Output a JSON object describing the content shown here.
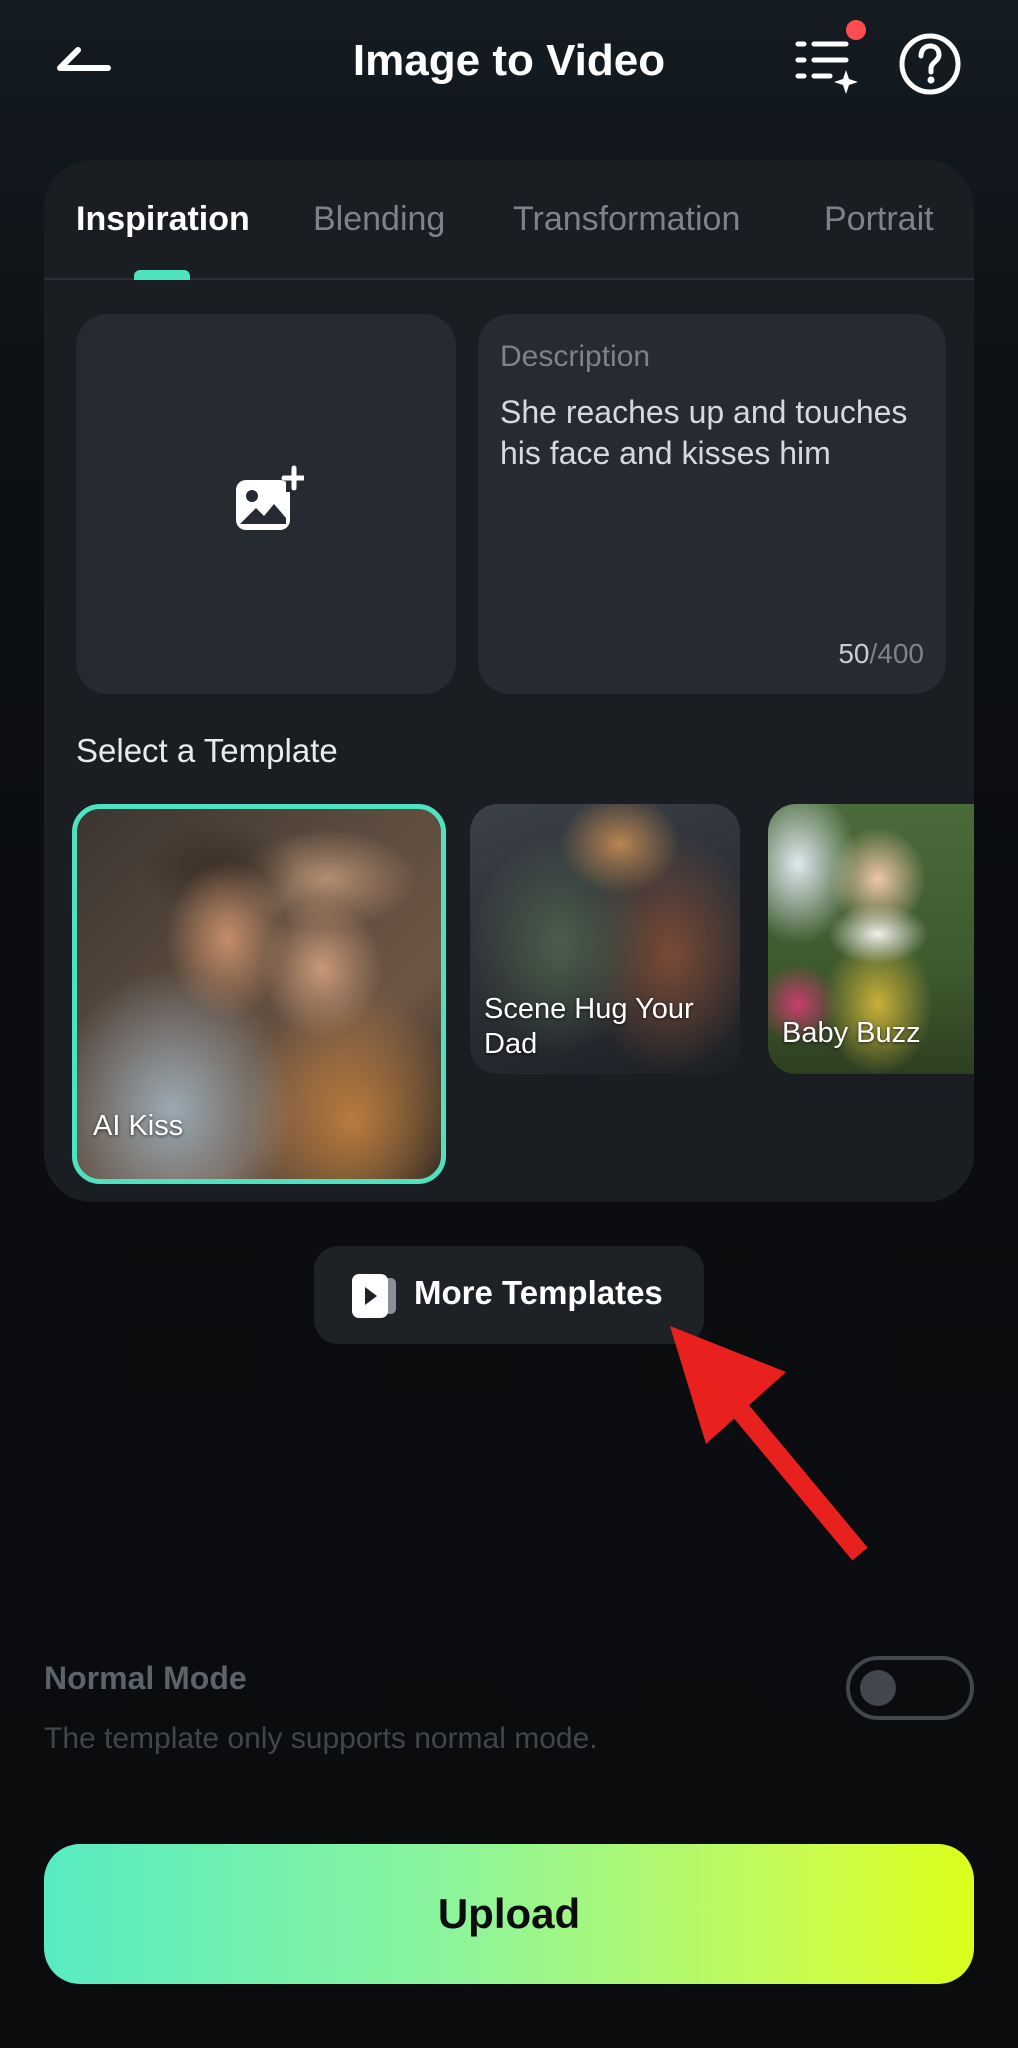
{
  "header": {
    "title": "Image to Video"
  },
  "tabs": [
    {
      "label": "Inspiration",
      "active": true
    },
    {
      "label": "Blending",
      "active": false
    },
    {
      "label": "Transformation",
      "active": false
    },
    {
      "label": "Portrait",
      "active": false
    }
  ],
  "description": {
    "label": "Description",
    "text": "She reaches up and touches his face and kisses him",
    "count": "50",
    "max": "/400"
  },
  "templates": {
    "section_label": "Select a Template",
    "items": [
      {
        "caption": "AI Kiss",
        "selected": true
      },
      {
        "caption": "Scene Hug Your Dad",
        "selected": false
      },
      {
        "caption": "Baby Buzz",
        "selected": false
      }
    ],
    "more_label": "More Templates"
  },
  "mode": {
    "title": "Normal Mode",
    "subtitle": "The template only supports normal mode.",
    "enabled": false
  },
  "upload_button": {
    "label": "Upload"
  },
  "colors": {
    "accent": "#4ee2c0",
    "notification": "#ff4d4f",
    "annotation_arrow": "#e8201e",
    "upload_gradient_start": "#57ebc2",
    "upload_gradient_end": "#dcff1a"
  }
}
